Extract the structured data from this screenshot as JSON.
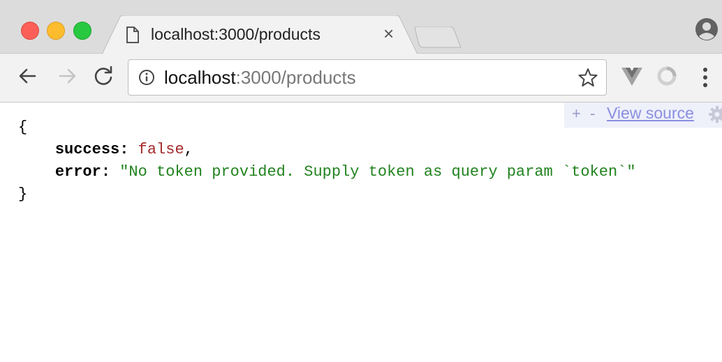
{
  "tab": {
    "title": "localhost:3000/products",
    "close": "×"
  },
  "address_bar": {
    "host": "localhost",
    "rest": ":3000/products"
  },
  "view_source": {
    "plus": "+",
    "minus": "-",
    "link": "View source"
  },
  "json_view": {
    "open_brace": "{",
    "close_brace": "}",
    "fields": [
      {
        "key": "success",
        "value": "false",
        "trailing": ","
      },
      {
        "key": "error",
        "value": "\"No token provided. Supply token as query param `token`\"",
        "trailing": ""
      }
    ]
  },
  "colors": {
    "bool": "#a52a2a",
    "string": "#21831f",
    "view_source_link": "#8a8ee0"
  },
  "icons": [
    "page-icon",
    "close-icon",
    "profile-icon",
    "back-arrow-icon",
    "forward-arrow-icon",
    "reload-icon",
    "info-icon",
    "star-icon",
    "vue-devtools-icon",
    "extension-icon",
    "menu-icon",
    "gear-icon"
  ]
}
